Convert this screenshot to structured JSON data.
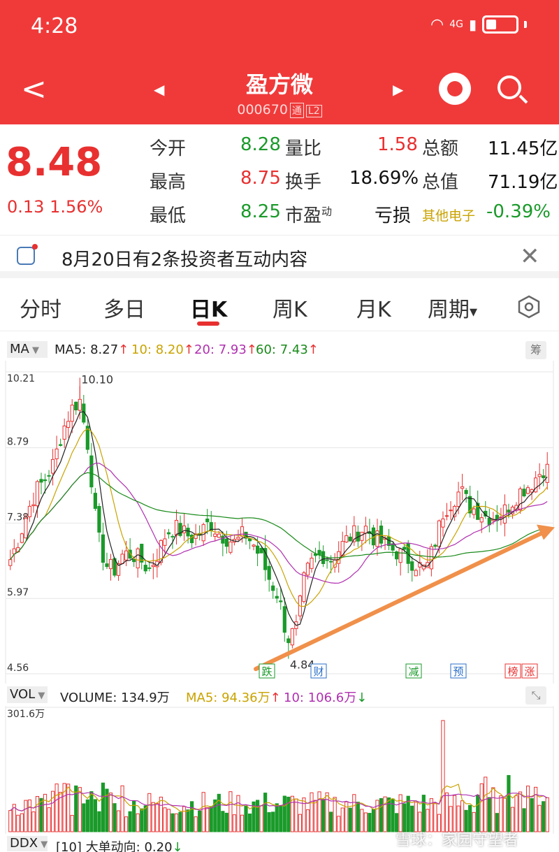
{
  "status_bar": {
    "time": "4:28",
    "network": "4G"
  },
  "header": {
    "back": "<",
    "prev": "◀",
    "next": "▶",
    "stock_name": "盈方微",
    "stock_code": "000670",
    "badge_tong": "通",
    "badge_l2": "L2"
  },
  "quote": {
    "price": "8.48",
    "change": "0.13",
    "change_pct": "1.56%",
    "rows": [
      {
        "l1": "今开",
        "v1": "8.28",
        "l2": "量比",
        "v2": "1.58",
        "l3": "总额",
        "v3": "11.45亿"
      },
      {
        "l1": "最高",
        "v1": "8.75",
        "l2": "换手",
        "v2": "18.69%",
        "l3": "总值",
        "v3": "71.19亿"
      },
      {
        "l1": "最低",
        "v1": "8.25",
        "l2": "市盈",
        "l2_sup": "动",
        "v2": "亏损",
        "l3": "其他电子",
        "v3": "-0.39%"
      }
    ]
  },
  "notice": {
    "text": "8月20日有2条投资者互动内容",
    "close": "✕"
  },
  "tabs": [
    "分时",
    "多日",
    "日K",
    "周K",
    "月K",
    "周期"
  ],
  "tab_active_index": 2,
  "tab_dropdown_arrow": "▾",
  "ma_bar": {
    "selector": "MA",
    "ma5": "MA5: 8.27",
    "ma10": "10: 8.20",
    "ma20": "20: 7.93",
    "ma60": "60: 7.43",
    "arrow": "↑",
    "chip": "筹"
  },
  "vol_bar": {
    "selector": "VOL",
    "volume": "VOLUME: 134.9万",
    "ma5": "MA5: 94.36万",
    "ma10": "10: 106.6万",
    "up": "↑",
    "down": "↓",
    "expand": "⤡"
  },
  "ddx_bar": {
    "selector": "DDX",
    "text": "[10] 大单动向: 0.20",
    "arrow": "↓"
  },
  "watermark": "雪球：家园守望者",
  "chart_data": [
    {
      "type": "candlestick",
      "name": "日K",
      "y_ticks": [
        "10.21",
        "8.79",
        "7.38",
        "5.97",
        "4.56"
      ],
      "ylim": [
        4.56,
        10.21
      ],
      "annotations": [
        {
          "text": "10.10",
          "kind": "period-high",
          "value": 10.1
        },
        {
          "text": "4.84",
          "kind": "period-low",
          "value": 4.84
        }
      ],
      "event_markers": [
        {
          "label": "跌",
          "color": "#1a9a2a"
        },
        {
          "label": "财",
          "color": "#2a6fc9"
        },
        {
          "label": "减",
          "color": "#1a9a2a"
        },
        {
          "label": "预",
          "color": "#2a6fc9"
        },
        {
          "label": "榜",
          "color": "#e83030"
        },
        {
          "label": "涨",
          "color": "#e83030"
        }
      ],
      "trend_arrow": {
        "color": "#f0904a",
        "from": 4.65,
        "to": 7.3
      },
      "price_path": [
        6.7,
        7.1,
        7.6,
        8.0,
        8.2,
        8.5,
        9.1,
        9.5,
        9.7,
        8.8,
        7.2,
        6.6,
        6.5,
        6.8,
        6.8,
        6.7,
        6.5,
        6.8,
        7.2,
        7.3,
        7.2,
        7.1,
        7.2,
        7.4,
        7.2,
        7.1,
        7.0,
        7.2,
        7.0,
        6.7,
        6.3,
        6.0,
        5.2,
        5.4,
        6.4,
        6.7,
        6.8,
        6.7,
        6.9,
        7.1,
        7.2,
        7.3,
        7.1,
        7.0,
        6.9,
        6.8,
        6.7,
        6.6,
        6.5,
        7.0,
        7.6,
        7.8,
        8.0,
        7.7,
        7.6,
        7.5,
        7.5,
        7.6,
        7.8,
        8.0,
        8.1,
        8.3,
        8.48
      ],
      "series": [
        {
          "name": "MA5",
          "color": "#222222",
          "value": "8.27"
        },
        {
          "name": "10",
          "color": "#c9a300",
          "value": "8.20"
        },
        {
          "name": "20",
          "color": "#b030b0",
          "value": "7.93"
        },
        {
          "name": "60",
          "color": "#1a8a1a",
          "value": "7.43"
        }
      ]
    },
    {
      "type": "bar",
      "name": "VOL",
      "y_ticks": [
        "301.6万"
      ],
      "ylim": [
        0,
        301.6
      ],
      "series": [
        {
          "name": "VOLUME",
          "value": "134.9万"
        },
        {
          "name": "MA5",
          "color": "#c9a300",
          "value": "94.36万"
        },
        {
          "name": "10",
          "color": "#b030b0",
          "value": "106.6万"
        }
      ]
    }
  ]
}
